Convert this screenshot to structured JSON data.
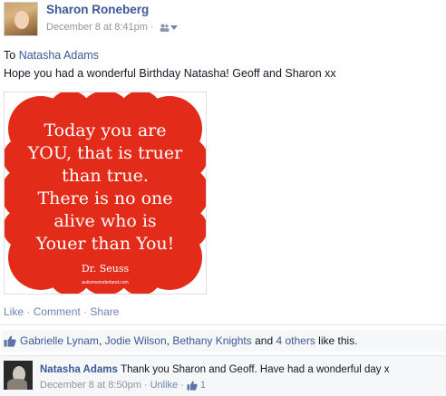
{
  "post": {
    "author": "Sharon Roneberg",
    "timestamp": "December 8 at 8:41pm",
    "separator": "·",
    "audience_icon": "friends-icon",
    "to_prefix": "To",
    "to_name": "Natasha Adams",
    "message": "Hope you had a wonderful Birthday Natasha! Geoff and Sharon xx",
    "image": {
      "lines": [
        "Today you are",
        "YOU, that is truer",
        "than true.",
        "There is no one",
        "alive who is",
        "Youer than You!"
      ],
      "attribution": "Dr. Seuss",
      "site": "autismwonderland.com",
      "bg_color": "#e32b1a"
    },
    "actions": {
      "like": "Like",
      "comment": "Comment",
      "share": "Share",
      "dot": "·"
    }
  },
  "likes": {
    "names": [
      "Gabrielle Lynam",
      "Jodie Wilson",
      "Bethany Knights"
    ],
    "comma": ",",
    "and": "and",
    "others": "4 others",
    "suffix": "like this."
  },
  "comment": {
    "author": "Natasha Adams",
    "text": "Thank you Sharon and Geoff. Have had a wonderful day x",
    "timestamp": "December 8 at 8:50pm",
    "dot": "·",
    "unlike": "Unlike",
    "like_count": "1"
  },
  "colors": {
    "link": "#3b5998",
    "meta": "#90949c",
    "image_red": "#e32b1a"
  }
}
